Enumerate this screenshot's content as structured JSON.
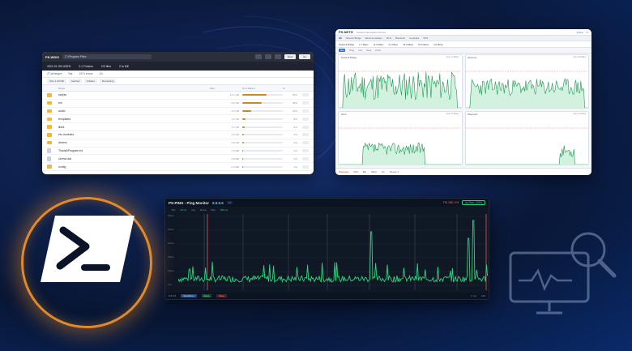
{
  "colors": {
    "accent": "#2bd67b",
    "folder": "#f0b73a",
    "logo_ring": "#e08a2a",
    "danger": "#c0392b"
  },
  "file_window": {
    "brand": "PS-WDIV",
    "path": "C:\\Program Files",
    "buttons": [
      "Scan",
      "Go"
    ],
    "stats": [
      "2021.91 GB USED",
      "2.1 Folders",
      "2/3 files",
      "2 to ME"
    ],
    "bar2": [
      "27 privileges",
      "Bar",
      "1571 errors",
      "Go"
    ],
    "chips": [
      "Size 1.00 GB",
      "Cached",
      "Folders",
      "Remaining"
    ],
    "columns": [
      "Name",
      "Size",
      "% of Parent",
      "%"
    ],
    "rows": [
      {
        "name": "scripts",
        "size": "12.1 GB",
        "pct": 60
      },
      {
        "name": "bin",
        "size": "9.9 GB",
        "pct": 48
      },
      {
        "name": "audio",
        "size": "4.2 GB",
        "pct": 22
      },
      {
        "name": "templates",
        "size": "1.6 GB",
        "pct": 8
      },
      {
        "name": "lib64",
        "size": "1.1 GB",
        "pct": 5
      },
      {
        "name": "etc-modules",
        "size": "0.9 GB",
        "pct": 4
      },
      {
        "name": "drivers",
        "size": "0.6 GB",
        "pct": 3
      },
      {
        "name": "ThisIsAProgram.txt",
        "size": "1.2 MB",
        "pct": 1
      },
      {
        "name": "UnInst.dat",
        "size": "0.8 MB",
        "pct": 1
      },
      {
        "name": "config",
        "size": "0.4 MB",
        "pct": 1
      }
    ]
  },
  "net_window": {
    "brand": "PS-NETG",
    "subtitle": "Network Bandwidth Monitor",
    "status": "Active",
    "tabs": [
      "All",
      "Network Bridge",
      "Ethernet Adapter",
      "Wi-Fi",
      "Bluetooth",
      "Loopback",
      "VPN"
    ],
    "metrics": [
      "Network Bridge",
      "1.7 Mbps",
      "11.9 Mbps",
      "9.2 Mbps",
      "79.0 Mbps",
      "19.0 Mbps",
      "4.6 Mbps"
    ],
    "sub": [
      "Net",
      "Ping",
      "Con",
      "Sess",
      "Ports"
    ],
    "panels": [
      {
        "title": "Network Bridge",
        "stat": "Avg 1.2 Mbps"
      },
      {
        "title": "Ethernet",
        "stat": "Avg 1.8 Mbps"
      },
      {
        "title": "Wi-Fi",
        "stat": "Avg 0.4 Mbps"
      },
      {
        "title": "Bluetooth",
        "stat": "Avg 0.1 Mbps"
      }
    ],
    "footer": [
      "Protected",
      "VPN",
      "Bar",
      "Mbps",
      "Go",
      "Stream 1"
    ]
  },
  "ping_window": {
    "brand": "PS-PING - Ping Monitor",
    "address": "8.8.8.8",
    "version": "v2",
    "stat": "TRL 286 / 1%",
    "status_pill": "UpTime: 100%",
    "legend": [
      "Min",
      "20 ms",
      "Avg",
      "32 ms",
      "Max",
      "286 ms"
    ],
    "y_ticks": [
      "500ms",
      "400ms",
      "300ms",
      "200ms",
      "100ms",
      "0ms"
    ],
    "footer_left": "8.8.8.8",
    "buttons": [
      "Start/Stop",
      "Save",
      "Stop"
    ],
    "footer_right": [
      "0 ms",
      "100"
    ]
  }
}
